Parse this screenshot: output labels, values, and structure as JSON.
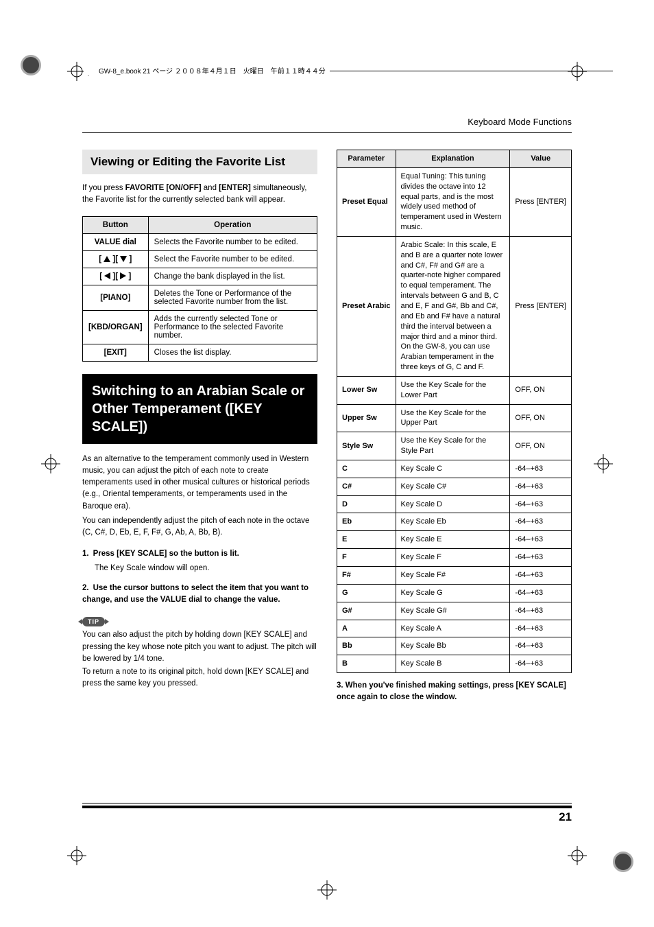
{
  "print_header": "GW-8_e.book 21 ページ ２００８年４月１日　火曜日　午前１１時４４分",
  "running_head": "Keyboard Mode Functions",
  "favorite_section": {
    "title": "Viewing or Editing the Favorite List",
    "intro_1": "If you press ",
    "intro_bold_1": "FAVORITE [ON/OFF]",
    "intro_2": " and ",
    "intro_bold_2": "[ENTER]",
    "intro_3": " simultaneously, the Favorite list for the currently selected bank will appear.",
    "table_headers": {
      "button": "Button",
      "operation": "Operation"
    },
    "rows": [
      {
        "button": "VALUE dial",
        "operation": "Selects the Favorite number to be edited."
      },
      {
        "button": "ARROW_UPDOWN",
        "operation": "Select the Favorite number to be edited."
      },
      {
        "button": "ARROW_LEFTRIGHT",
        "operation": "Change the bank displayed in the list."
      },
      {
        "button": "[PIANO]",
        "operation": "Deletes the Tone or Performance of the selected Favorite number from the list."
      },
      {
        "button": "[KBD/ORGAN]",
        "operation": "Adds the currently selected Tone or Performance to the selected Favorite number."
      },
      {
        "button": "[EXIT]",
        "operation": "Closes the list display."
      }
    ]
  },
  "key_scale_section": {
    "title": "Switching to an Arabian Scale or Other Temperament ([KEY SCALE])",
    "para_1": "As an alternative to the temperament commonly used in Western music, you can adjust the pitch of each note to create temperaments used in other musical cultures or historical periods (e.g., Oriental temperaments, or temperaments used in the Baroque era).",
    "para_2": "You can independently adjust the pitch of each note in the octave (C, C#, D, Eb, E, F, F#, G, Ab, A, Bb, B).",
    "step1": {
      "num": "1.",
      "lead": "Press [KEY SCALE] so the button is lit.",
      "sub": "The Key Scale window will open."
    },
    "step2": {
      "num": "2.",
      "lead": "Use the cursor buttons to select the item that you want to change, and use the VALUE dial to change the value."
    },
    "tip_label": "TIP",
    "tip_body_1": "You can also adjust the pitch by holding down [KEY SCALE] and pressing the key whose note pitch you want to adjust. The pitch will be lowered by 1/4 tone.",
    "tip_body_2": "To return a note to its original pitch, hold down [KEY SCALE] and press the same key you pressed.",
    "step3": {
      "num": "3.",
      "lead": "When you've finished making settings, press [KEY SCALE] once again to close the window."
    }
  },
  "params_table": {
    "headers": {
      "parameter": "Parameter",
      "explanation": "Explanation",
      "value": "Value"
    },
    "rows": [
      {
        "param": "Preset Equal",
        "explanation": "Equal Tuning: This tuning divides the octave into 12 equal parts, and is the most widely used method of temperament used in Western music.",
        "value": "Press [ENTER]"
      },
      {
        "param": "Preset Arabic",
        "explanation": "Arabic Scale: In this scale, E and B are a quarter note lower and C#, F# and G# are a quarter-note higher compared to equal temperament. The intervals between G and B, C and E, F and G#, Bb and C#, and Eb and F# have a natural third the interval between a major third and a minor third. On the GW-8, you can use Arabian temperament in the three keys of G, C and F.",
        "value": "Press [ENTER]"
      },
      {
        "param": "Lower Sw",
        "explanation": "Use the Key Scale for the Lower Part",
        "value": "OFF, ON"
      },
      {
        "param": "Upper Sw",
        "explanation": "Use the Key Scale for the Upper Part",
        "value": "OFF, ON"
      },
      {
        "param": "Style Sw",
        "explanation": "Use the Key Scale for the Style Part",
        "value": "OFF, ON"
      },
      {
        "param": "C",
        "explanation": "Key Scale C",
        "value": "-64–+63"
      },
      {
        "param": "C#",
        "explanation": "Key Scale C#",
        "value": "-64–+63"
      },
      {
        "param": "D",
        "explanation": "Key Scale D",
        "value": "-64–+63"
      },
      {
        "param": "Eb",
        "explanation": "Key Scale Eb",
        "value": "-64–+63"
      },
      {
        "param": "E",
        "explanation": "Key Scale E",
        "value": "-64–+63"
      },
      {
        "param": "F",
        "explanation": "Key Scale F",
        "value": "-64–+63"
      },
      {
        "param": "F#",
        "explanation": "Key Scale F#",
        "value": "-64–+63"
      },
      {
        "param": "G",
        "explanation": "Key Scale G",
        "value": "-64–+63"
      },
      {
        "param": "G#",
        "explanation": "Key Scale G#",
        "value": "-64–+63"
      },
      {
        "param": "A",
        "explanation": "Key Scale A",
        "value": "-64–+63"
      },
      {
        "param": "Bb",
        "explanation": "Key Scale Bb",
        "value": "-64–+63"
      },
      {
        "param": "B",
        "explanation": "Key Scale B",
        "value": "-64–+63"
      }
    ]
  },
  "page_number": "21"
}
